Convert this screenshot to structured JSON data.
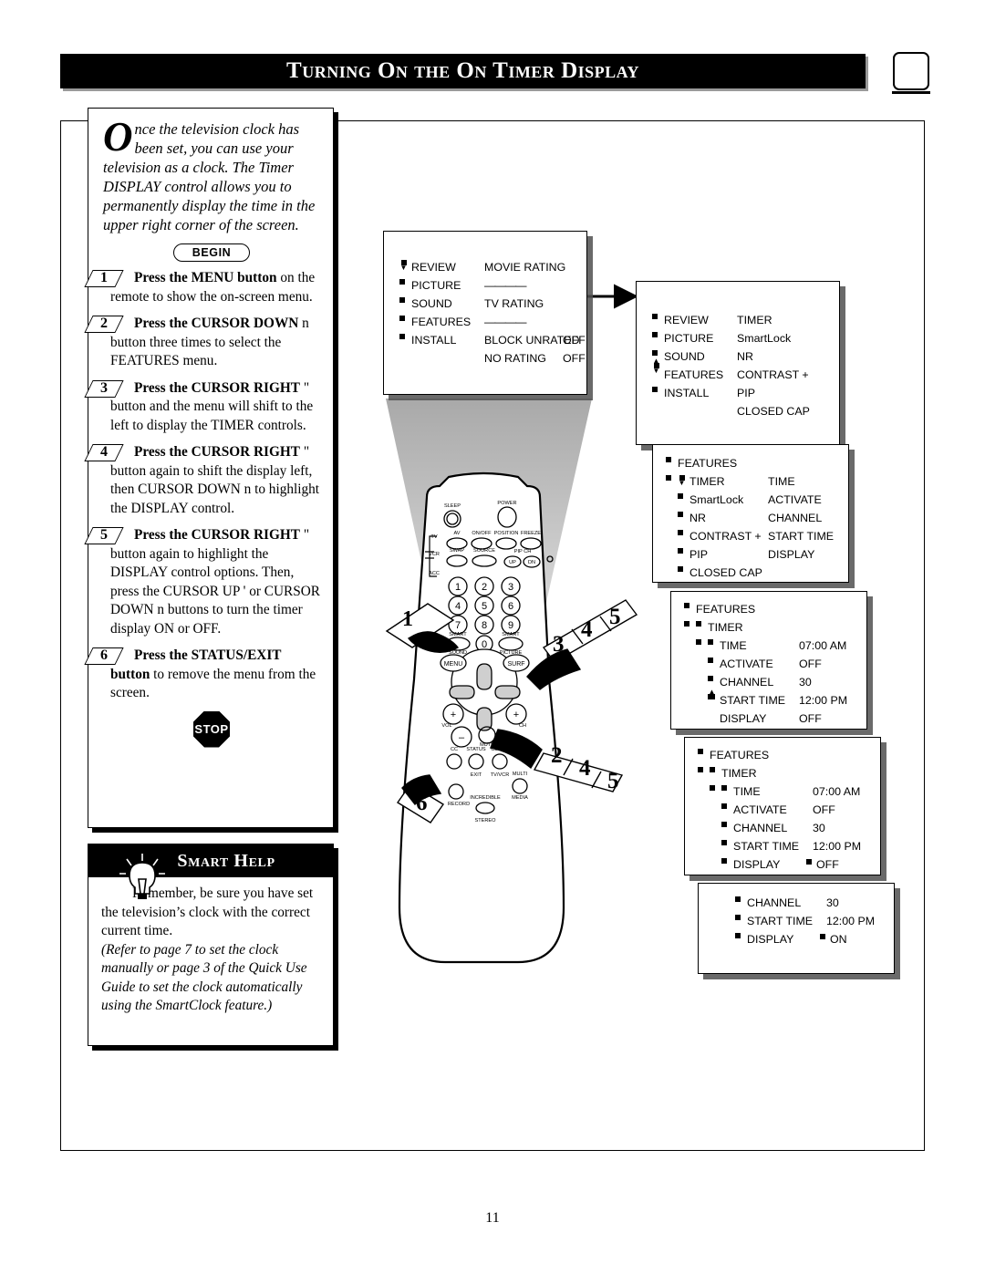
{
  "page": {
    "title": "Turning On the On Timer Display",
    "number": "11",
    "tv_icon": "tv-screen-icon"
  },
  "intro": {
    "dropcap": "O",
    "text": "nce the television clock has been set, you can use your television as a clock. The Timer DISPLAY control allows you to permanently display the time in the upper right corner of the screen."
  },
  "begin_badge": "BEGIN",
  "stop_badge": "STOP",
  "steps": [
    {
      "num": "1",
      "lead": "Press the MENU button",
      "rest": " on the remote to show the on-screen menu."
    },
    {
      "num": "2",
      "lead": "Press the CURSOR DOWN",
      "glyph": "n",
      "rest": " button three times to select the FEATURES menu."
    },
    {
      "num": "3",
      "lead": "Press the CURSOR RIGHT",
      "glyph": "\"",
      "rest": " button and the menu will shift to the left to display the TIMER controls."
    },
    {
      "num": "4",
      "lead": "Press the CURSOR RIGHT",
      "glyph": "\"",
      "rest": " button again to shift the display left, then CURSOR DOWN n to highlight the DISPLAY control."
    },
    {
      "num": "5",
      "lead": "Press the CURSOR RIGHT",
      "glyph": "\"",
      "rest": " button again to highlight the DISPLAY control options. Then, press the CURSOR UP ' or CURSOR DOWN n buttons to turn the timer display ON or OFF."
    },
    {
      "num": "6",
      "lead": "Press the STATUS/EXIT button",
      "rest": " to remove the menu from the screen."
    }
  ],
  "smart_help": {
    "header": "Smart Help",
    "icon": "lightbulb-icon",
    "paragraph1": "Remember, be sure you have set the television’s clock with the correct current time.",
    "paragraph2": "(Refer to page 7 to set the clock manually or page 3 of the Quick Use Guide to set the clock automatically using the SmartClock feature.)"
  },
  "osd_screens": [
    {
      "id": "menu-main",
      "left_items": [
        "REVIEW",
        "PICTURE",
        "SOUND",
        "FEATURES",
        "INSTALL"
      ],
      "right_items": [
        {
          "label": "MOVIE RATING",
          "value": ""
        },
        {
          "label": "————",
          "value": ""
        },
        {
          "label": "TV RATING",
          "value": ""
        },
        {
          "label": "————",
          "value": ""
        },
        {
          "label": "BLOCK UNRATED",
          "value": "OFF"
        },
        {
          "label": "NO RATING",
          "value": "OFF"
        }
      ],
      "cursor_on": "REVIEW"
    },
    {
      "id": "menu-features-selected",
      "left_items": [
        "REVIEW",
        "PICTURE",
        "SOUND",
        "FEATURES",
        "INSTALL"
      ],
      "right_items": [
        {
          "label": "TIMER",
          "value": ""
        },
        {
          "label": "SmartLock",
          "value": ""
        },
        {
          "label": "NR",
          "value": ""
        },
        {
          "label": "CONTRAST +",
          "value": ""
        },
        {
          "label": "PIP",
          "value": ""
        },
        {
          "label": "CLOSED CAP",
          "value": ""
        }
      ],
      "cursor_on": "FEATURES"
    },
    {
      "id": "menu-features-shifted",
      "header1": "FEATURES",
      "left_items": [
        "TIMER",
        "SmartLock",
        "NR",
        "CONTRAST +",
        "PIP",
        "CLOSED CAP"
      ],
      "right_items": [
        {
          "label": "TIME",
          "value": ""
        },
        {
          "label": "ACTIVATE",
          "value": ""
        },
        {
          "label": "CHANNEL",
          "value": ""
        },
        {
          "label": "START TIME",
          "value": ""
        },
        {
          "label": "DISPLAY",
          "value": ""
        }
      ],
      "cursor_on": "TIMER"
    },
    {
      "id": "menu-timer-values",
      "header1": "FEATURES",
      "header2": "TIMER",
      "rows": [
        {
          "label": "TIME",
          "value": "07:00 AM"
        },
        {
          "label": "ACTIVATE",
          "value": "OFF"
        },
        {
          "label": "CHANNEL",
          "value": "30"
        },
        {
          "label": "START TIME",
          "value": "12:00 PM"
        },
        {
          "label": "DISPLAY",
          "value": "OFF"
        }
      ],
      "cursor_on": "DISPLAY"
    },
    {
      "id": "menu-display-highlight",
      "header1": "FEATURES",
      "header2": "TIMER",
      "rows": [
        {
          "label": "TIME",
          "value": "07:00 AM"
        },
        {
          "label": "ACTIVATE",
          "value": "OFF"
        },
        {
          "label": "CHANNEL",
          "value": "30"
        },
        {
          "label": "START TIME",
          "value": "12:00 PM"
        },
        {
          "label": "DISPLAY",
          "value": "OFF",
          "value_cursor": "\""
        }
      ],
      "cursor_on": "DISPLAY"
    },
    {
      "id": "menu-display-on",
      "rows": [
        {
          "label": "CHANNEL",
          "value": "30"
        },
        {
          "label": "START TIME",
          "value": "12:00 PM"
        },
        {
          "label": "DISPLAY",
          "value": "ON",
          "value_cursor": "\""
        }
      ]
    }
  ],
  "remote": {
    "name": "remote-control-illustration",
    "buttons": {
      "sleep": "SLEEP",
      "power": "POWER",
      "tv": "TV",
      "vcr": "VCR",
      "acc": "ACC",
      "av": "AV",
      "onoff": "ON/OFF",
      "position": "POSITION",
      "freeze": "FREEZE",
      "swap": "SWAP",
      "source": "SOURCE",
      "pipch": "PIP CH",
      "up": "UP",
      "dn": "DN",
      "digits": [
        "1",
        "2",
        "3",
        "4",
        "5",
        "6",
        "7",
        "8",
        "9",
        "0"
      ],
      "smart_sound": "SMART SOUND",
      "smart_picture": "SMART PICTURE",
      "menu": "MENU",
      "surf": "SURF",
      "vol": "VOL",
      "ch": "CH",
      "mute": "MUTE",
      "cc": "CC",
      "status_exit": "STATUS EXIT",
      "clock_tvvcr": "CLOCK TV/VCR",
      "record": "RECORD",
      "multi_media": "MULTI MEDIA",
      "incredible_stereo": "INCREDIBLE STEREO"
    },
    "callouts": [
      {
        "id": "callout-1",
        "labels": [
          "1"
        ]
      },
      {
        "id": "callout-345",
        "labels": [
          "3",
          "4",
          "5"
        ]
      },
      {
        "id": "callout-245",
        "labels": [
          "2",
          "4",
          "5"
        ]
      },
      {
        "id": "callout-6",
        "labels": [
          "6"
        ]
      }
    ]
  }
}
